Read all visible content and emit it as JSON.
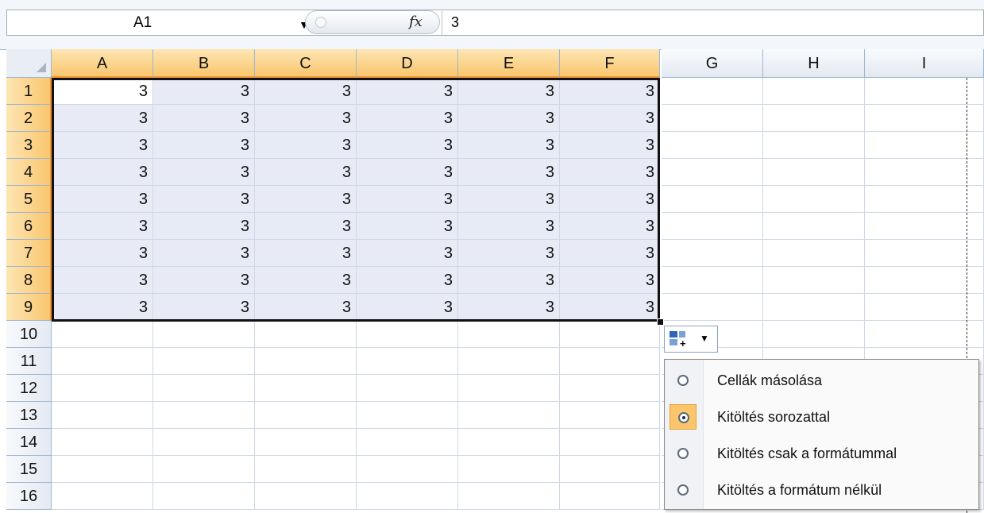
{
  "name_box": {
    "value": "A1"
  },
  "formula_bar": {
    "fx_label": "fx",
    "value": "3"
  },
  "columns": [
    "A",
    "B",
    "C",
    "D",
    "E",
    "F",
    "G",
    "H",
    "I"
  ],
  "rows": [
    "1",
    "2",
    "3",
    "4",
    "5",
    "6",
    "7",
    "8",
    "9",
    "10",
    "11",
    "12",
    "13",
    "14",
    "15",
    "16"
  ],
  "cell_values": [
    [
      "3",
      "3",
      "3",
      "3",
      "3",
      "3"
    ],
    [
      "3",
      "3",
      "3",
      "3",
      "3",
      "3"
    ],
    [
      "3",
      "3",
      "3",
      "3",
      "3",
      "3"
    ],
    [
      "3",
      "3",
      "3",
      "3",
      "3",
      "3"
    ],
    [
      "3",
      "3",
      "3",
      "3",
      "3",
      "3"
    ],
    [
      "3",
      "3",
      "3",
      "3",
      "3",
      "3"
    ],
    [
      "3",
      "3",
      "3",
      "3",
      "3",
      "3"
    ],
    [
      "3",
      "3",
      "3",
      "3",
      "3",
      "3"
    ],
    [
      "3",
      "3",
      "3",
      "3",
      "3",
      "3"
    ]
  ],
  "selection": {
    "range": "A1:F9",
    "active_cell": "A1"
  },
  "autofill_options": {
    "icon": "autofill-options-icon",
    "items": [
      {
        "label": "Cellák másolása",
        "checked": false
      },
      {
        "label": "Kitöltés sorozattal",
        "checked": true
      },
      {
        "label": "Kitöltés csak a formátummal",
        "checked": false
      },
      {
        "label": "Kitöltés a formátum nélkül",
        "checked": false
      }
    ]
  },
  "colors": {
    "selection_fill": "#e8ebf5",
    "header_selected": "#f9c66e",
    "menu_checked": "#fbc66b"
  }
}
